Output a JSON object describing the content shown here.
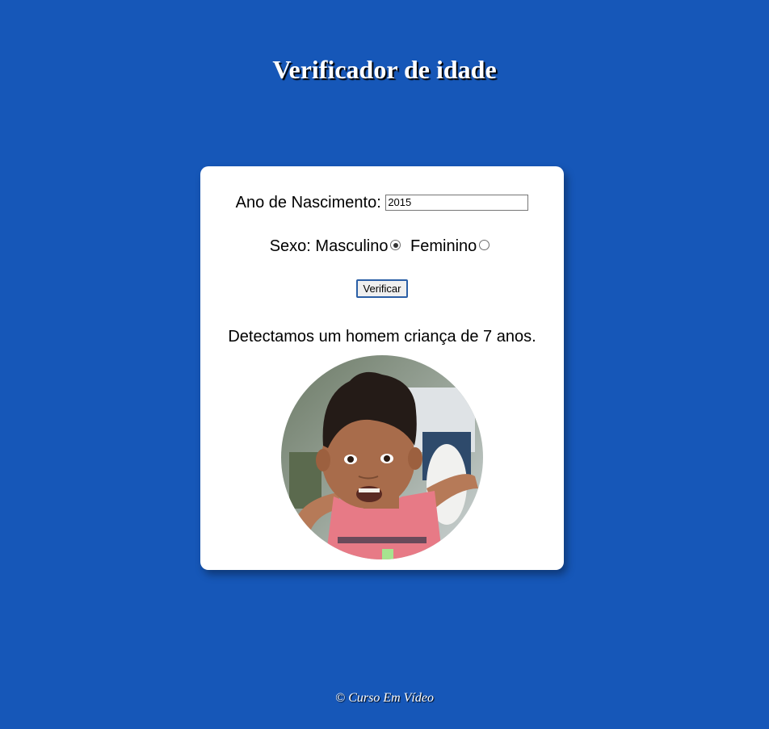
{
  "header": {
    "title": "Verificador de idade"
  },
  "form": {
    "birth_year_label": "Ano de Nascimento:",
    "birth_year_value": "2015",
    "sex_label": "Sexo:",
    "sex_options": [
      {
        "label": "Masculino",
        "checked": true
      },
      {
        "label": "Feminino",
        "checked": false
      }
    ],
    "verify_button_label": "Verificar"
  },
  "result": {
    "text": "Detectamos um homem criança de 7 anos.",
    "photo_subject": "boy-child-photo"
  },
  "footer": {
    "text": "© Curso Em Vídeo"
  },
  "colors": {
    "background": "#1657b8",
    "card": "#ffffff",
    "button_border": "#2b5fa6"
  }
}
